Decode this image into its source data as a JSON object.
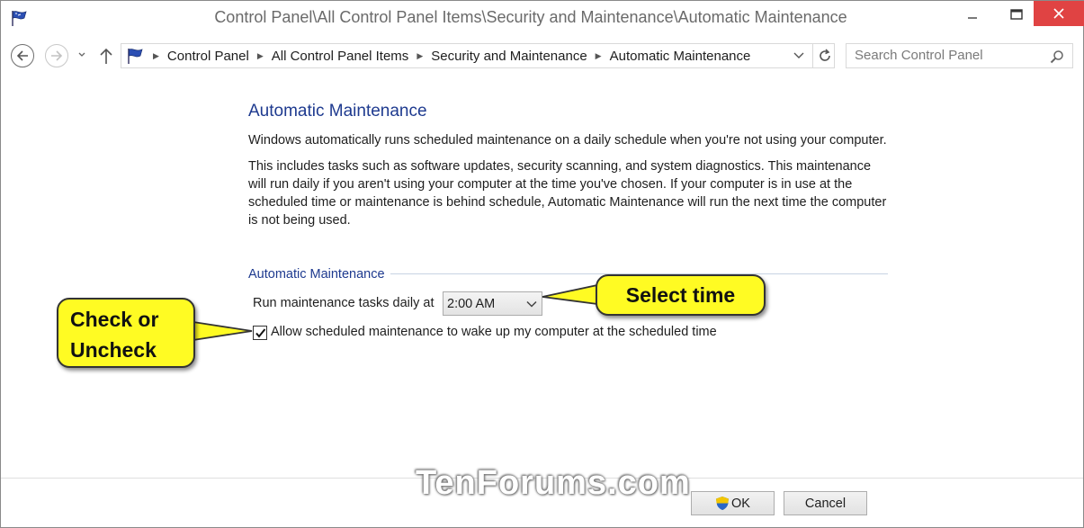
{
  "window": {
    "title": "Control Panel\\All Control Panel Items\\Security and Maintenance\\Automatic Maintenance"
  },
  "address": {
    "breadcrumbs": [
      "Control Panel",
      "All Control Panel Items",
      "Security and Maintenance",
      "Automatic Maintenance"
    ]
  },
  "search": {
    "placeholder": "Search Control Panel"
  },
  "main": {
    "title": "Automatic Maintenance",
    "intro": "Windows automatically runs scheduled maintenance on a daily schedule when you're not using your computer.",
    "details": "This includes tasks such as software updates, security scanning, and system diagnostics. This maintenance will run daily if you aren't using your computer at the time you've chosen. If your computer is in use at the scheduled time or maintenance is behind schedule, Automatic Maintenance will run the next time the computer is not being used.",
    "group_label": "Automatic Maintenance",
    "run_label": "Run maintenance tasks daily at",
    "time_value": "2:00 AM",
    "wake_checkbox_label": "Allow scheduled maintenance to wake up my computer at the scheduled time",
    "wake_checked": true
  },
  "buttons": {
    "ok": "OK",
    "cancel": "Cancel"
  },
  "annotations": {
    "select_time": "Select time",
    "check_line1": "Check or",
    "check_line2": "Uncheck",
    "color": "#fffb23"
  },
  "watermark": "TenForums.com"
}
